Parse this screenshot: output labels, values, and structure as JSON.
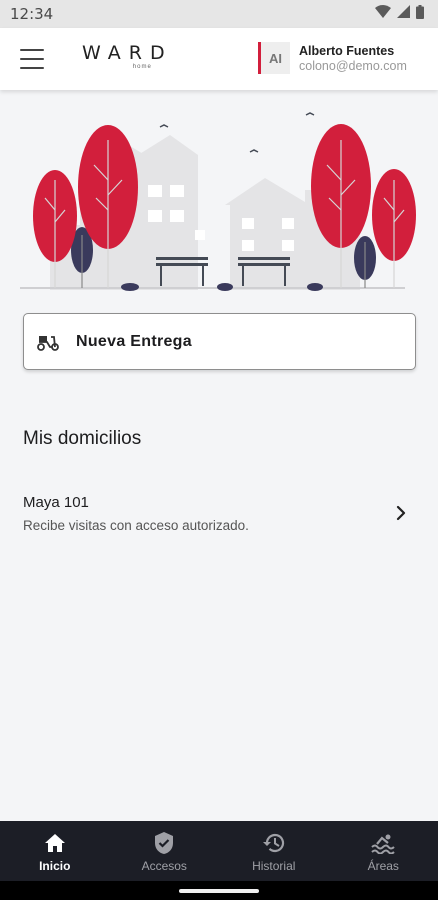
{
  "status_bar": {
    "time": "12:34",
    "icons": [
      "wifi-icon",
      "signal-icon",
      "battery-icon"
    ]
  },
  "header": {
    "logo_text": "WARD",
    "logo_subtext": "home",
    "menu_icon": "hamburger-menu-icon",
    "user": {
      "initials": "AI",
      "name": "Alberto Fuentes",
      "email": "colono@demo.com"
    }
  },
  "hero": {
    "illustration": "neighborhood-illustration"
  },
  "delivery": {
    "icon": "scooter-icon",
    "label": "Nueva Entrega"
  },
  "homes": {
    "title": "Mis domicilios",
    "items": [
      {
        "name": "Maya 101",
        "description": "Recibe visitas con acceso autorizado."
      }
    ]
  },
  "bottom_nav": {
    "items": [
      {
        "label": "Inicio",
        "icon": "home-icon",
        "active": true
      },
      {
        "label": "Accesos",
        "icon": "shield-check-icon",
        "active": false
      },
      {
        "label": "Historial",
        "icon": "history-icon",
        "active": false
      },
      {
        "label": "Áreas",
        "icon": "pool-icon",
        "active": false
      }
    ]
  },
  "colors": {
    "accent": "#d21f3c",
    "nav_background": "#1c1e26",
    "page_background": "#f4f5f7",
    "tree_dark": "#3a3a5c"
  }
}
